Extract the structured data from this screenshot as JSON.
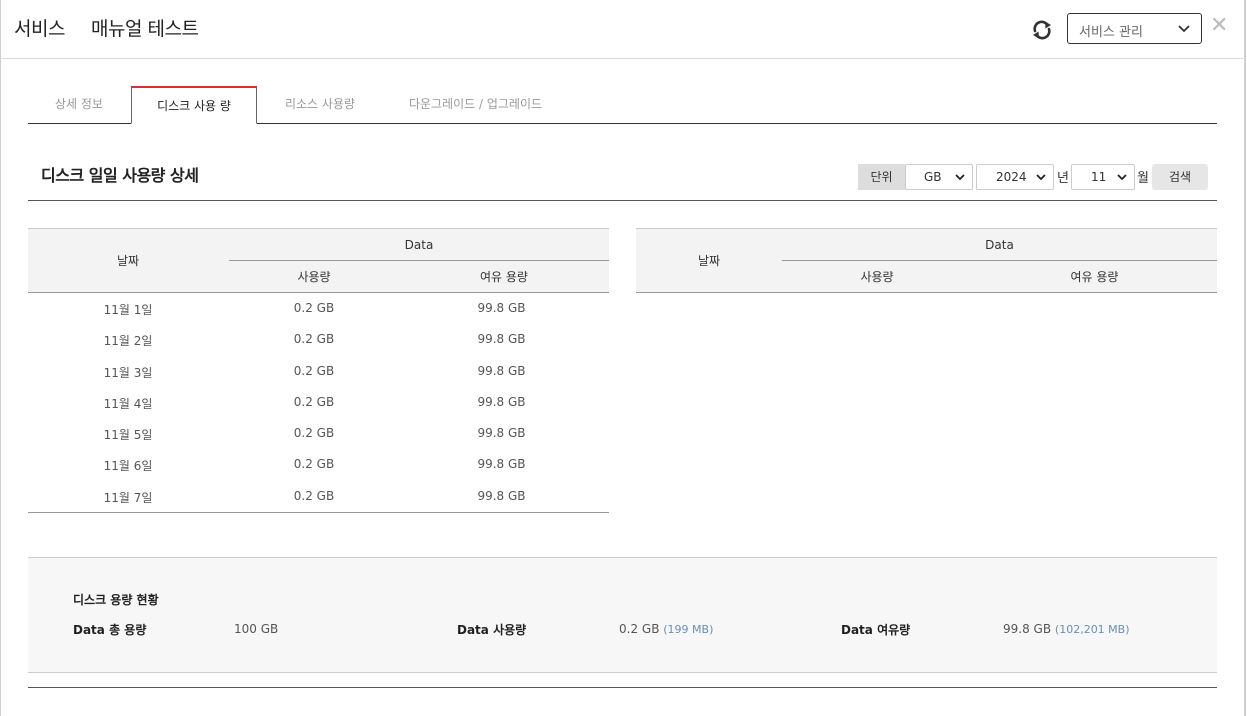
{
  "header": {
    "title_main": "서비스",
    "title_sub": "매뉴얼 테스트",
    "service_select": "서비스 관리",
    "close_symbol": "✕"
  },
  "tabs": [
    {
      "label": "상세 정보",
      "active": false
    },
    {
      "label": "디스크 사용 량",
      "active": true
    },
    {
      "label": "리소스 사용량",
      "active": false
    },
    {
      "label": "다운그레이드 / 업그레이드",
      "active": false
    }
  ],
  "section": {
    "title": "디스크 일일 사용량 상세",
    "unit_label": "단위",
    "unit_value": "GB",
    "year_value": "2024",
    "year_suffix": "년",
    "month_value": "11",
    "month_suffix": "월",
    "search_label": "검색"
  },
  "table": {
    "col_date": "날짜",
    "col_data": "Data",
    "col_used": "사용량",
    "col_free": "여유 용량",
    "rows": [
      {
        "date": "11월 1일",
        "used": "0.2 GB",
        "free": "99.8 GB"
      },
      {
        "date": "11월 2일",
        "used": "0.2 GB",
        "free": "99.8 GB"
      },
      {
        "date": "11월 3일",
        "used": "0.2 GB",
        "free": "99.8 GB"
      },
      {
        "date": "11월 4일",
        "used": "0.2 GB",
        "free": "99.8 GB"
      },
      {
        "date": "11월 5일",
        "used": "0.2 GB",
        "free": "99.8 GB"
      },
      {
        "date": "11월 6일",
        "used": "0.2 GB",
        "free": "99.8 GB"
      },
      {
        "date": "11월 7일",
        "used": "0.2 GB",
        "free": "99.8 GB"
      }
    ]
  },
  "summary": {
    "title": "디스크 용량 현황",
    "total_label": "Data 총 용량",
    "total_value": "100 GB",
    "used_label": "Data 사용량",
    "used_value": "0.2 GB",
    "used_sub": "(199 MB)",
    "free_label": "Data 여유량",
    "free_value": "99.8 GB",
    "free_sub": "(102,201 MB)"
  },
  "colors": {
    "accent": "#d9312a",
    "header_bg": "#f3f3f3",
    "sub_value": "#6a8fb0"
  },
  "icons": {
    "refresh": "refresh-icon",
    "chevron": "chevron-down-icon",
    "close": "close-icon"
  }
}
